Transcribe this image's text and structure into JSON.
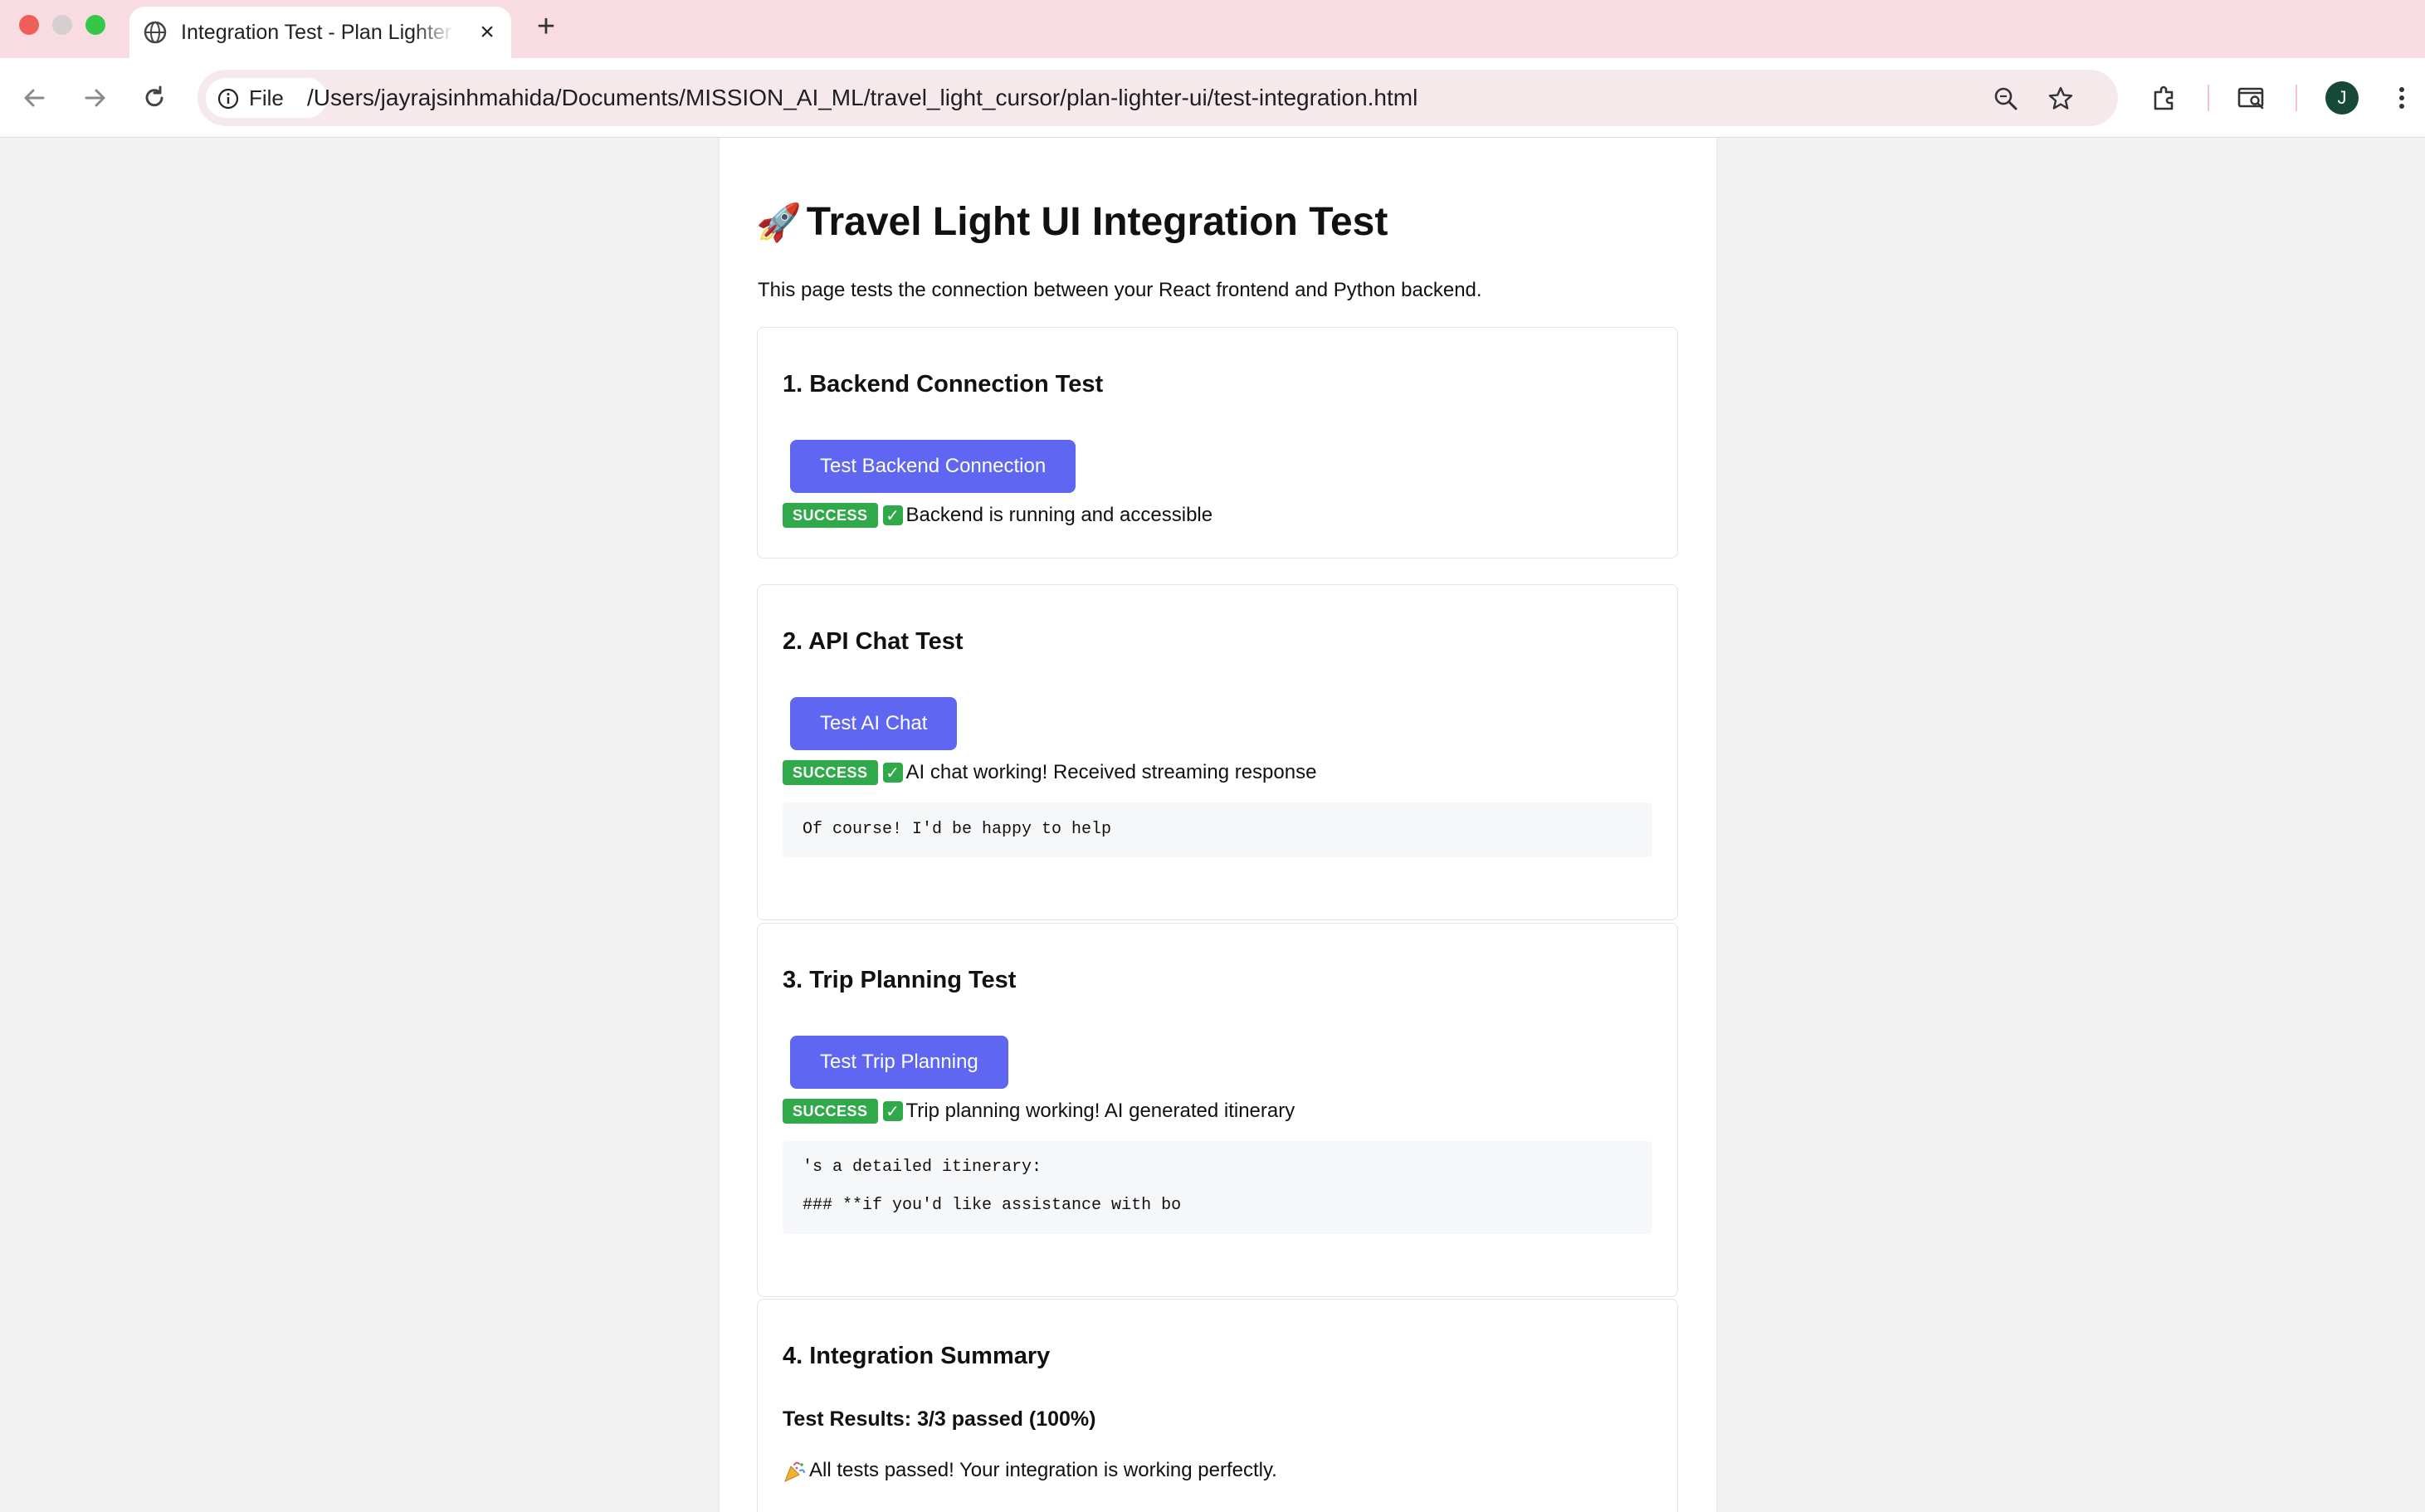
{
  "browser": {
    "tab_title": "Integration Test - Plan Lighter UI",
    "new_tab": "+",
    "close_tab": "×",
    "file_chip": "File",
    "url": "/Users/jayrajsinhmahida/Documents/MISSION_AI_ML/travel_light_cursor/plan-lighter-ui/test-integration.html",
    "avatar_initial": "J",
    "tab_bar_color": "#f8dce1"
  },
  "page": {
    "title": "Travel Light UI Integration Test",
    "title_emoji": "🚀",
    "intro": "This page tests the connection between your React frontend and Python backend."
  },
  "sections": [
    {
      "title": "1. Backend Connection Test",
      "button": "Test Backend Connection",
      "badge": "SUCCESS",
      "status": "Backend is running and accessible"
    },
    {
      "title": "2. API Chat Test",
      "button": "Test AI Chat",
      "badge": "SUCCESS",
      "status": "AI chat working! Received streaming response",
      "output": [
        "Of course! I'd be happy to help"
      ]
    },
    {
      "title": "3. Trip Planning Test",
      "button": "Test Trip Planning",
      "badge": "SUCCESS",
      "status": "Trip planning working! AI generated itinerary",
      "output": [
        "'s a detailed itinerary:",
        "### **if you'd like assistance with bo"
      ]
    }
  ],
  "summary": {
    "title": "4. Integration Summary",
    "results": "Test Results: 3/3 passed (100%)",
    "message": "All tests passed! Your integration is working perfectly."
  },
  "colors": {
    "button": "#5f66f2",
    "success": "#2fa94a"
  }
}
